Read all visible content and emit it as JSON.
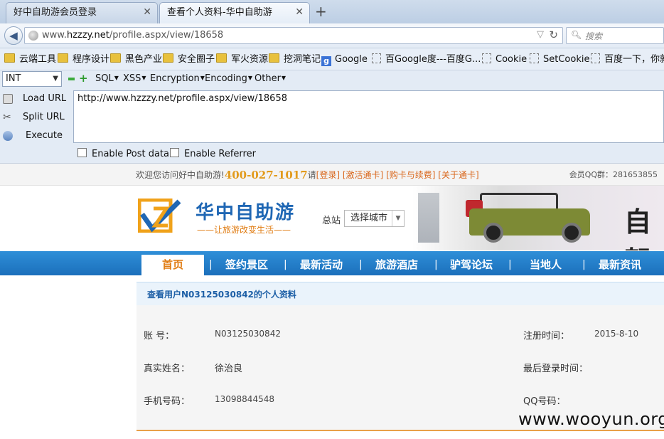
{
  "browser": {
    "tabs": [
      {
        "title": "好中自助游会员登录",
        "active": false
      },
      {
        "title": "查看个人资料-华中自助游",
        "active": true
      }
    ],
    "new_tab_label": "+",
    "url_prefix": "www.",
    "url_domain": "hzzzy.net",
    "url_path": "/profile.aspx/view/18658",
    "search_placeholder": "搜索",
    "bookmarks": [
      {
        "label": "云端工具",
        "icon": "folder-icon"
      },
      {
        "label": "程序设计",
        "icon": "folder-icon"
      },
      {
        "label": "黑色产业",
        "icon": "folder-icon"
      },
      {
        "label": "安全圈子",
        "icon": "folder-icon"
      },
      {
        "label": "军火资源",
        "icon": "folder-icon"
      },
      {
        "label": "挖洞笔记",
        "icon": "folder-icon"
      },
      {
        "label": "Google",
        "icon": "google-icon"
      },
      {
        "label": "百Google度---百度G...",
        "icon": "page-icon"
      },
      {
        "label": "Cookie",
        "icon": "page-icon"
      },
      {
        "label": "SetCookie",
        "icon": "page-icon"
      },
      {
        "label": "百度一下，你就",
        "icon": "page-icon"
      }
    ]
  },
  "hackbar": {
    "type_select": "INT",
    "menus": [
      "SQL",
      "XSS",
      "Encryption",
      "Encoding",
      "Other"
    ],
    "actions": [
      "Load URL",
      "Split URL",
      "Execute"
    ],
    "url_value": "http://www.hzzzy.net/profile.aspx/view/18658",
    "checkboxes": [
      "Enable Post data",
      "Enable Referrer"
    ]
  },
  "site": {
    "welcome_prefix": "欢迎您访问好中自助游!",
    "phone": "400-027-1017",
    "please": "请",
    "top_links": [
      "[登录]",
      "[激活通卡]",
      "[购卡与续费]",
      "[关于通卡]"
    ],
    "member_qq": "会员QQ群：281653855",
    "logo_title": "华中自助游",
    "logo_slogan": "——让旅游改变生活——",
    "station_label": "总站",
    "city_select": "选择城市",
    "nav": [
      "首页",
      "签约景区",
      "最新活动",
      "旅游酒店",
      "驴驾论坛",
      "当地人",
      "最新资讯"
    ],
    "nav_separator": "|"
  },
  "profile": {
    "title": "查看用户N03125030842的个人资料",
    "fields": {
      "account_label": "账  号：",
      "account_value": "N03125030842",
      "register_label": "注册时间：",
      "register_value": "2015-8-10",
      "realname_label": "真实姓名：",
      "realname_value": "徐治良",
      "lastlogin_label": "最后登录时间：",
      "phone_label": "手机号码：",
      "phone_value": "13098844548",
      "qq_label": "QQ号码："
    }
  },
  "watermark": "www.wooyun.org",
  "colors": {
    "accent_blue": "#1f67b4",
    "nav_blue": "#2f8fd8",
    "orange": "#e07d14"
  }
}
